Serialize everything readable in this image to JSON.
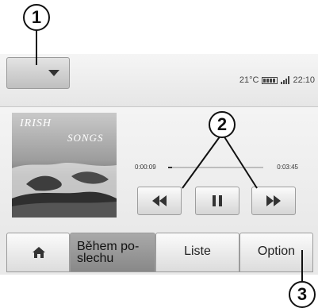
{
  "callouts": [
    "1",
    "2",
    "3"
  ],
  "status": {
    "temperature": "21°C",
    "time": "22:10"
  },
  "album": {
    "line1": "IRISH",
    "line2": "SONGS"
  },
  "player": {
    "elapsed": "0:00:09",
    "total": "0:03:45",
    "progress": 0.04
  },
  "tabs": [
    {
      "label": "",
      "icon": "home-icon"
    },
    {
      "label": "Během po- slechu"
    },
    {
      "label": "Liste"
    },
    {
      "label": "Option"
    }
  ],
  "icons": {
    "dropdown": "chevron-down-icon",
    "battery": "battery-icon",
    "signal": "signal-icon",
    "rewind": "rewind-icon",
    "pause": "pause-icon",
    "fast_forward": "fast-forward-icon"
  }
}
